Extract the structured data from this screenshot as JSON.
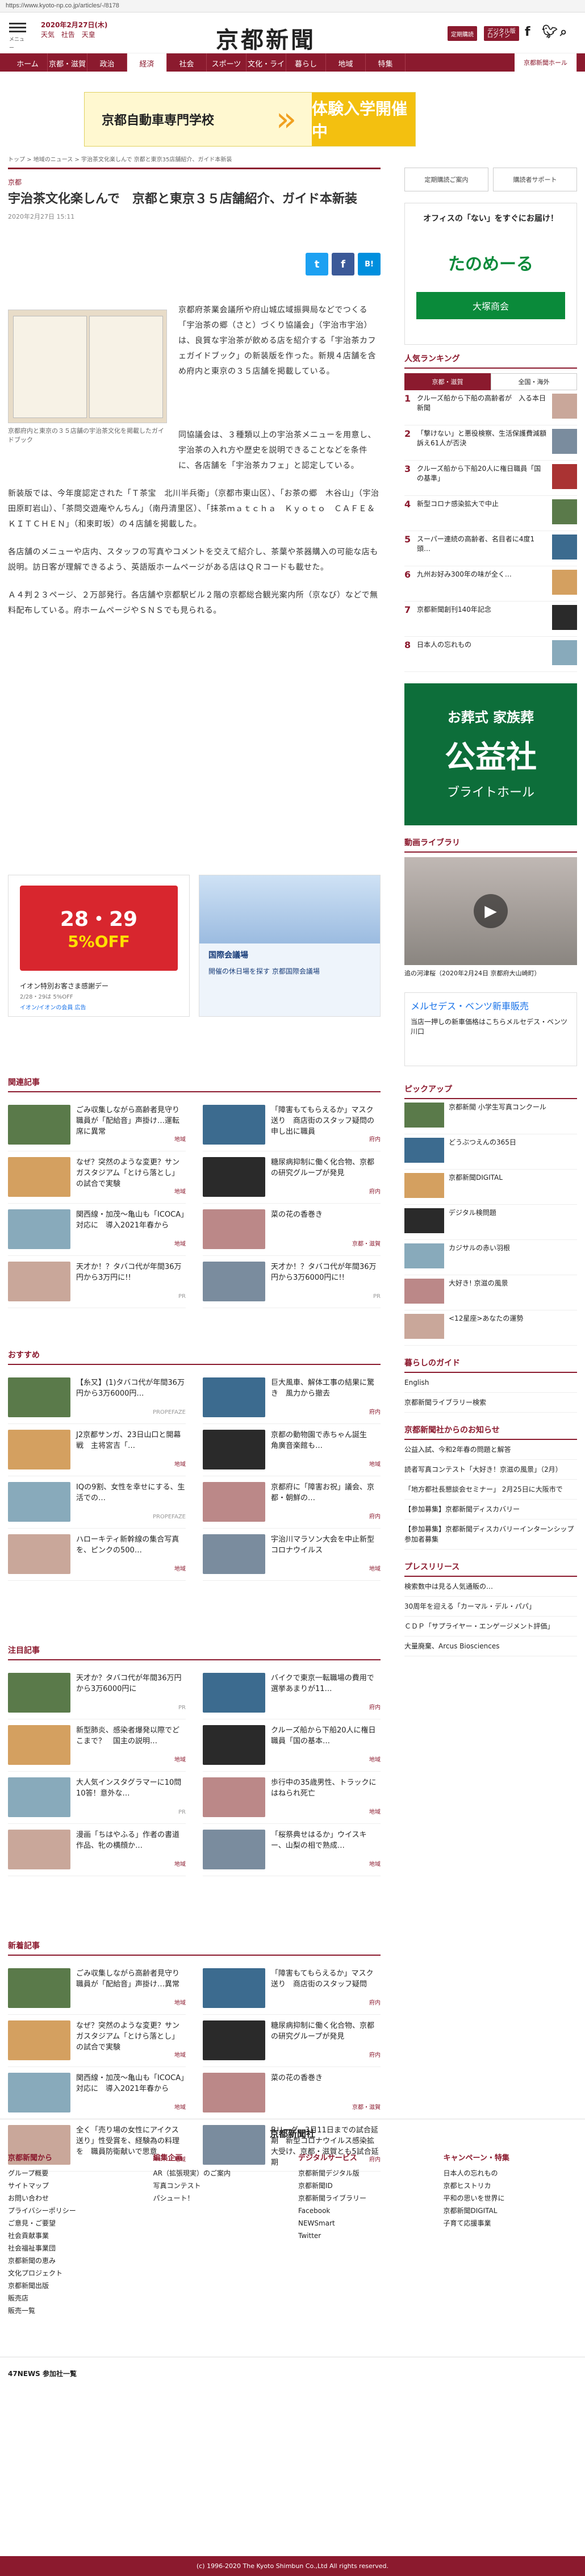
{
  "browser": {
    "url": "https://www.kyoto-np.co.jp/articles/-/8178"
  },
  "header": {
    "menu_label": "メニュー",
    "date": "2020年2月27日(木)",
    "weather": [
      "天気",
      "社告",
      "天皇"
    ],
    "logo": "京都新聞",
    "btn_member": "定期購読",
    "btn_digital": "デジタル版ログイン",
    "social": [
      "Facebook",
      "Twitter",
      "検索"
    ]
  },
  "nav": {
    "items": [
      "ホーム",
      "京都・滋賀",
      "政治",
      "経済",
      "社会",
      "スポーツ",
      "文化・ライフ",
      "暮らし",
      "地域",
      "特集"
    ],
    "special": "京都新聞ホール",
    "active": 3
  },
  "topad": {
    "school": "京都自動車専門学校",
    "cta": "体験入学開催中"
  },
  "breadcrumb": "トップ > 地域のニュース > 宇治茶文化楽しんで 京都と東京35店舗紹介、ガイド本新装",
  "article": {
    "category": "京都",
    "title": "宇治茶文化楽しんで　京都と東京３５店舗紹介、ガイド本新装",
    "time": "2020年2月27日 15:11",
    "caption": "京都府内と東京の３５店舗の宇治茶文化を掲載したガイドブック",
    "p1": "京都府茶業会議所や府山城広域振興局などでつくる「宇治茶の郷（さと）づくり協議会」（宇治市宇治）は、良質な宇治茶が飲める店を紹介する「宇治茶カフェガイドブック」の新装版を作った。新規４店舗を含め府内と東京の３５店舗を掲載している。",
    "p2": "同協議会は、３種類以上の宇治茶メニューを用意し、宇治茶の入れ方や歴史を説明できることなどを条件に、各店舗を「宇治茶カフェ」と認定している。",
    "p3": "新装版では、今年度認定された「Ｔ茶宝　北川半兵衛」（京都市東山区）、「お茶の郷　木谷山」（宇治田原町岩山）、「茶問交遊庵やんちん」（南丹清里区）、「抹茶ｍａｔｃｈａ　Ｋｙｏｔｏ　ＣＡＦＥ＆ＫＩＴＣＨＥＮ」（和束町坂）の４店舗を掲載した。",
    "p4": "各店舗のメニューや店内、スタッフの写真やコメントを交えて紹介し、茶葉や茶器購入の可能な店も説明。訪日客が理解できるよう、英語版ホームページがある店はＱＲコードも載せた。",
    "p5": "Ａ４判２３ページ、２万部発行。各店舗や京都駅ビル２階の京都総合観光案内所（京なび）などで無料配布している。府ホームページやＳＮＳでも見られる。",
    "share": [
      "t",
      "f",
      "B!"
    ]
  },
  "ads": {
    "left_title": "イオン特別お客さま感謝デー",
    "left_sub": "2/28・29は 5%OFF",
    "left_small": "イオン/イオンの会員 広告",
    "left_big": "28・29",
    "left_off": "5%OFF",
    "right_title": "国際会議場",
    "right_sub": "開催の休日場を探す 京都国際会議場"
  },
  "related": {
    "heading": "関連記事",
    "items": [
      {
        "t": "ごみ収集しながら高齢者見守り　職員が「配給音」声掛け…運転席に異常",
        "tag": "地域"
      },
      {
        "t": "「障害もてもらえるか」マスク送り　商店街のスタッフ疑問の申し出に職員",
        "tag": "府内"
      },
      {
        "t": "なぜ？突然のような変更？サンガスタジアム「とけら落とし」の試合で実験",
        "tag": "地域"
      },
      {
        "t": "糖尿病抑制に働く化合物、京都の研究グループが発見",
        "tag": "府内"
      },
      {
        "t": "関西線・加茂～亀山も「ICOCA」対応に　導入2021年春から",
        "tag": "地域"
      },
      {
        "t": "菜の花の香巻き",
        "tag": "京都・滋賀"
      },
      {
        "t": "天才か！？タバコ代が年間36万円から3万円に!!",
        "tag": "PR"
      },
      {
        "t": "天才か！？タバコ代が年間36万円から3万6000円に!!",
        "tag": "PR"
      }
    ]
  },
  "osusume": {
    "heading": "おすすめ",
    "items": [
      {
        "t": "【糸又】(1)タバコ代が年間36万円から3万6000円…",
        "tag": "PROPEFAZE"
      },
      {
        "t": "巨大風車、解体工事の結果に驚き　風力から撤去",
        "tag": "府内"
      },
      {
        "t": "J2京都サンガ、23日山口と開幕戦　主将宮吉「…",
        "tag": "地域"
      },
      {
        "t": "京都の動物園で赤ちゃん誕生　角廣音楽館も…",
        "tag": "地域"
      },
      {
        "t": "IQの9割、女性を幸せにする、生活での…",
        "tag": "PROPEFAZE"
      },
      {
        "t": "京都府に「障害お祝」議会、京都・朝鮮の…",
        "tag": "府内"
      },
      {
        "t": "ハローキティ新幹線の集合写真を、ピンクの500…",
        "tag": "地域"
      },
      {
        "t": "宇治川マラソン大会を中止新型コロナウイルス",
        "tag": "地域"
      }
    ]
  },
  "attention": {
    "heading": "注目記事",
    "items": [
      {
        "t": "天才か？タバコ代が年間36万円から3万6000円に",
        "tag": "PR"
      },
      {
        "t": "バイクで東京一転職場の費用で選挙あまりが11…",
        "tag": "府内"
      },
      {
        "t": "新型肺炎、感染者爆発以際でどこまで？　国主の説明…",
        "tag": "地域"
      },
      {
        "t": "クルーズ船から下船20人に権日職員「国の基本…",
        "tag": "地域"
      },
      {
        "t": "大人気インスタグラマーに10問10答！意外な…",
        "tag": "PR"
      },
      {
        "t": "歩行中の35歳男性、トラックにはねられ死亡",
        "tag": "地域"
      },
      {
        "t": "漫画「ちはやふる」作者の書道作品、牝の横顔か…",
        "tag": "地域"
      },
      {
        "t": "「桜祭典せはるか」ウイスキー、山梨の相で熟成…",
        "tag": "地域"
      }
    ]
  },
  "newest": {
    "heading": "新着記事",
    "items": [
      {
        "t": "ごみ収集しながら高齢者見守り　職員が「配給音」声掛け…異常",
        "tag": "地域"
      },
      {
        "t": "「障害もてもらえるか」マスク送り　商店街のスタッフ疑問",
        "tag": "府内"
      },
      {
        "t": "なぜ？突然のような変更？サンガスタジアム「とけら落とし」の試合で実験",
        "tag": "地域"
      },
      {
        "t": "糖尿病抑制に働く化合物、京都の研究グループが発見",
        "tag": "府内"
      },
      {
        "t": "関西線・加茂～亀山も「ICOCA」対応に　導入2021年春から",
        "tag": "地域"
      },
      {
        "t": "菜の花の香巻き",
        "tag": "京都・滋賀"
      },
      {
        "t": "全く「売り場の女性にアイクス送り」性受賞を、経験為の料理を　職員防衛献いで思意",
        "tag": "地域"
      },
      {
        "t": "Bリーグ、3月11日までの試合延期　新型コロナウイルス感染拡大受け、京都・滋賀とも5試合延期",
        "tag": "府内"
      }
    ]
  },
  "sidebar": {
    "btn1": "定期購読ご案内",
    "btn2": "購読者サポート",
    "ad_top": "オフィスの「ない」をすぐにお届け！",
    "ad_brand": "たのめーる",
    "ad_corp": "大塚商会",
    "ranking_title": "人気ランキング",
    "rank_tabs": [
      "京都・滋賀",
      "全国・海外"
    ],
    "ranks": [
      "クルーズ船から下船の高齢者が　入る本日新聞",
      "「撃けない」と悪役検察、生活保護費減額　訴え61人が否決",
      "クルーズ船から下船20人に権日職員「国の基準」",
      "新型コロナ感染拡大で中止",
      "スーパー連続の高齢者、名目者に4度1頭…",
      "九州お好み300年の味が全く…",
      "京都新聞創刊140年記念",
      "日本人の忘れもの"
    ],
    "ad_funeral": "お葬式 家族葬",
    "ad_funeral2": "公益社",
    "ad_funeral3": "ブライトホール",
    "video_title": "動画ライブラリ",
    "video_caption": "追の河津桜（2020年2月24日 京都府大山崎町）",
    "mercedes": "メルセデス・ベンツ新車販売",
    "mercedes_sub": "当店一押しの新車価格はこちらメルセデス・ベンツ川口",
    "pickup_title": "ピックアップ",
    "pickup": [
      "京都新聞 小学生写真コンクール",
      "どうぶつえんの365日",
      "京都新聞DIGITAL",
      "デジタル検問題",
      "カジサルの赤い羽根",
      "大好き! 京滋の風景",
      "<12星座>あなたの運勢"
    ],
    "life_title": "暮らしのガイド",
    "life": [
      "English",
      "京都新聞ライブラリー検索"
    ],
    "notice_title": "京都新聞社からのお知らせ",
    "notice": [
      "公益入試、今和2年春の問題と解答",
      "読者写真コンテスト「大好き！京滋の風景」（2月）",
      "「地方都社長懇談会セミナー」 2月25日に大阪市で",
      "【参加募集】京都新聞ディスカバリー",
      "【参加募集】京都新聞ディスカバリーインターンシップ 参加者募集"
    ],
    "press_title": "プレスリリース",
    "press": [
      "検索数中は見る人気通販の…",
      "30周年を迎える「カーマル・デル・パパ」",
      "ＣＤＰ「サプライヤー・エンゲージメント評価」",
      "大量廃棄、Arcus Biosciences"
    ]
  },
  "footer": {
    "logo": "京都新聞社",
    "cols": [
      {
        "h": "京都新聞から",
        "items": [
          "グループ概要",
          "サイトマップ",
          "お問い合わせ",
          "プライバシーポリシー",
          "ご意見・ご要望",
          "社会貢献事業",
          "社会福祉事業団",
          "京都新聞の恵み",
          "文化プロジェクト",
          "京都新聞出版",
          "販売店",
          "販売一覧"
        ]
      },
      {
        "h": "編集企画",
        "items": [
          "AR（拡張現実）のご案内",
          "写真コンテスト",
          "パシュート！"
        ]
      },
      {
        "h": "デジタルサービス",
        "items": [
          "京都新聞デジタル版",
          "京都新聞ID",
          "京都新聞ライブラリー",
          "Facebook",
          "NEWSmart",
          "Twitter"
        ]
      },
      {
        "h": "キャンペーン・特集",
        "items": [
          "日本人の忘れもの",
          "京都ヒストリカ",
          "平和の思いを世界に",
          "京都新聞DIGITAL",
          "子育て応援事業"
        ]
      }
    ],
    "bottom_title": "47NEWS 参加社一覧",
    "copyright": "(c) 1996-2020 The Kyoto Shimbun Co.,Ltd All rights reserved."
  }
}
